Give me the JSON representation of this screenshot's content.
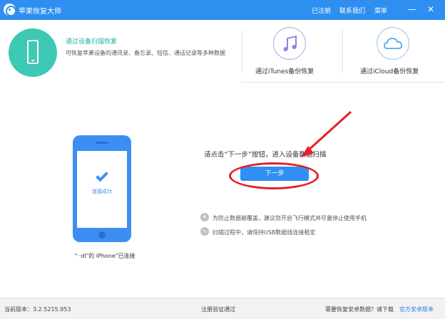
{
  "titlebar": {
    "app_title": "苹果恢复大师",
    "menu": [
      "已注册",
      "联系我们",
      "菜单"
    ],
    "minimize": "—",
    "close": "✕",
    "background_color": "#2e8ff0"
  },
  "modes": {
    "device_scan": {
      "title": "通过设备扫描恢复",
      "description": "可恢复苹果设备的通讯录、备忘录、短信、通话记录等多种数据",
      "icon": "phone-icon",
      "color": "#3ec9b4"
    },
    "itunes": {
      "label": "通过iTunes备份恢复",
      "icon": "music-note-icon"
    },
    "icloud": {
      "label": "通过iCloud备份恢复",
      "icon": "cloud-icon"
    }
  },
  "main": {
    "connected_status": "连接成功",
    "device_name": "\"··dl\"的 iPhone\"已连接",
    "instruction": "请点击“下一步”按钮，进入设备数据扫描",
    "next_button": "下一步",
    "notes": [
      "为防止数据被覆盖，建议您开启飞行模式并尽量停止使用手机",
      "扫描过程中，请保持USB数据线连接稳定"
    ],
    "annotation_color": "#e41f26",
    "accent_color": "#2f8ff3"
  },
  "statusbar": {
    "version": "当前版本：3.2.5215.953",
    "register": "注册验证通过",
    "android_prompt": "需要恢复安卓数据？请下载",
    "android_link": "官方安卓版本"
  }
}
